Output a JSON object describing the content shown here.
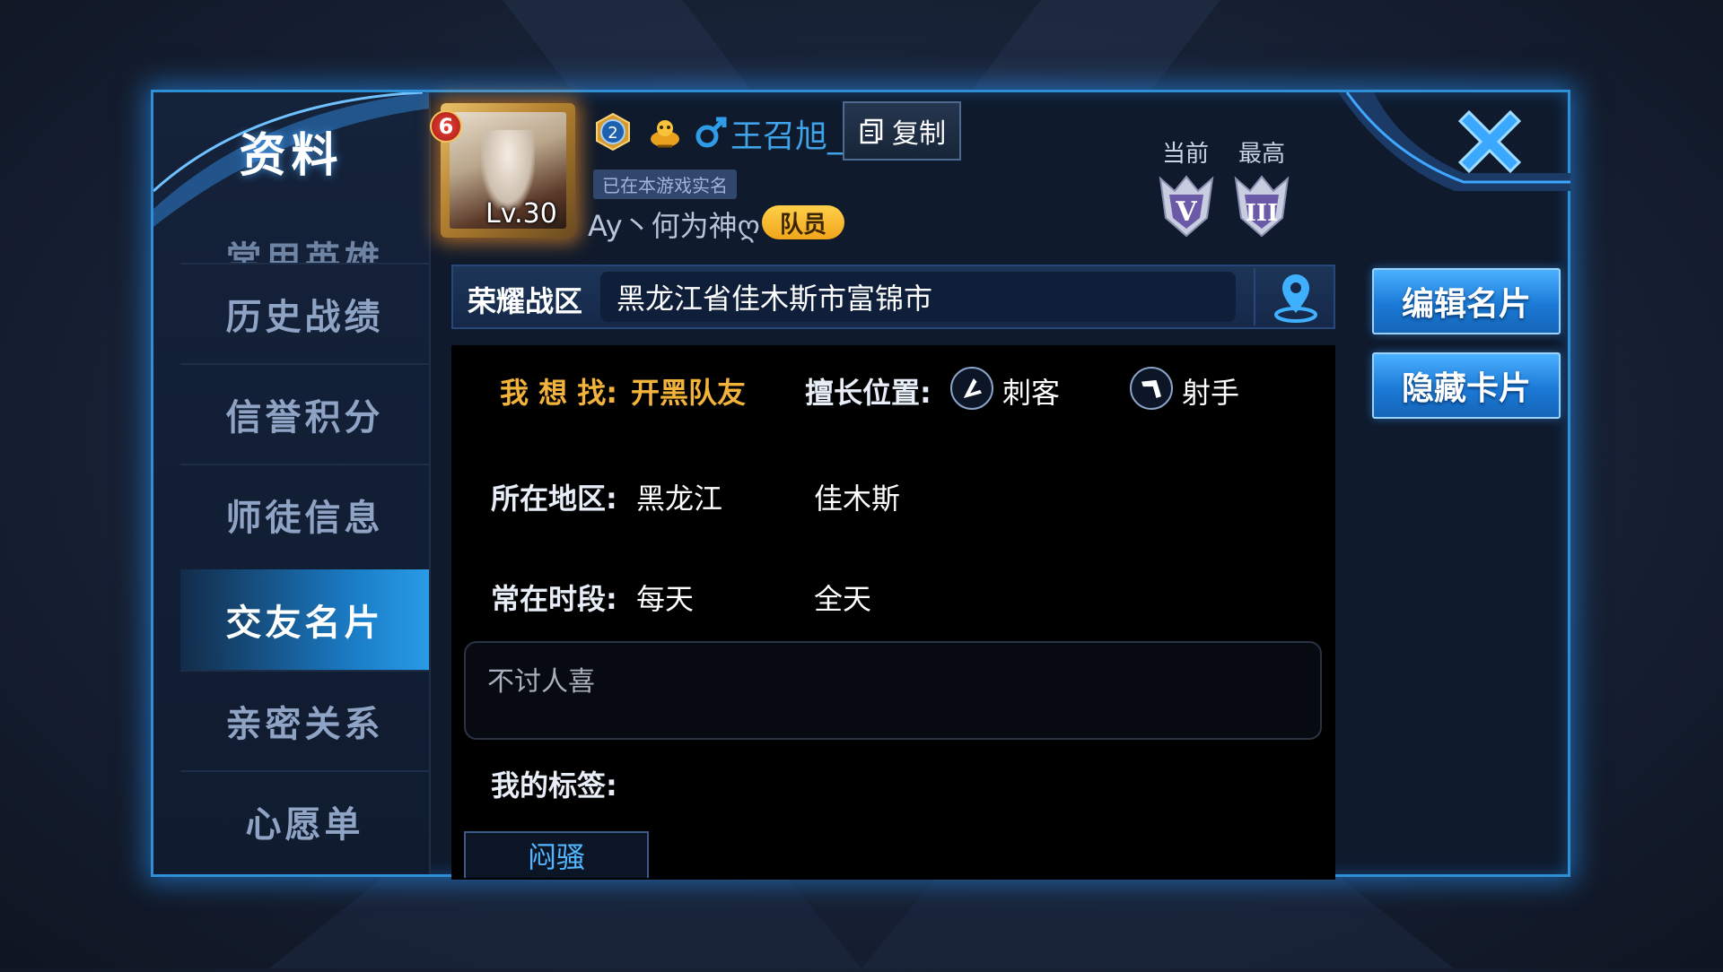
{
  "sidebar": {
    "title": "资料",
    "partial_item": "常用英雄",
    "items": [
      {
        "label": "历史战绩"
      },
      {
        "label": "信誉积分"
      },
      {
        "label": "师徒信息"
      },
      {
        "label": "交友名片",
        "active": true
      },
      {
        "label": "亲密关系"
      },
      {
        "label": "心愿单"
      }
    ]
  },
  "header": {
    "level_badge": "6",
    "level_text": "Lv.30",
    "rank_level": "2",
    "player_name": "王召旭_",
    "copy_label": "复制",
    "verified_tag": "已在本游戏实名",
    "club_name": "Ay丶何为神ღ",
    "role_badge": "队员",
    "rank_current_label": "当前",
    "rank_highest_label": "最高"
  },
  "region": {
    "label": "荣耀战区",
    "value": "黑龙江省佳木斯市富锦市"
  },
  "card": {
    "looking_for_label": "我 想 找:",
    "looking_for_value": "开黑队友",
    "position_label": "擅长位置:",
    "positions": [
      "刺客",
      "射手"
    ],
    "area_label": "所在地区:",
    "area_province": "黑龙江",
    "area_city": "佳木斯",
    "time_label": "常在时段:",
    "time_days": "每天",
    "time_range": "全天",
    "signature": "不讨人喜",
    "tags_label": "我的标签:",
    "tags": [
      "闷骚"
    ]
  },
  "actions": {
    "edit_card": "编辑名片",
    "hide_card": "隐藏卡片"
  },
  "colors": {
    "accent_blue": "#2a9be6",
    "orange_highlight": "#f2b33a",
    "name_blue": "#3fa3ea"
  },
  "icons": [
    "rank-2-icon",
    "mascot-icon",
    "male-icon",
    "copy-icon",
    "assassin-icon",
    "marksman-icon",
    "location-pin-icon",
    "close-icon",
    "rank-v-emblem",
    "rank-iii-emblem"
  ]
}
